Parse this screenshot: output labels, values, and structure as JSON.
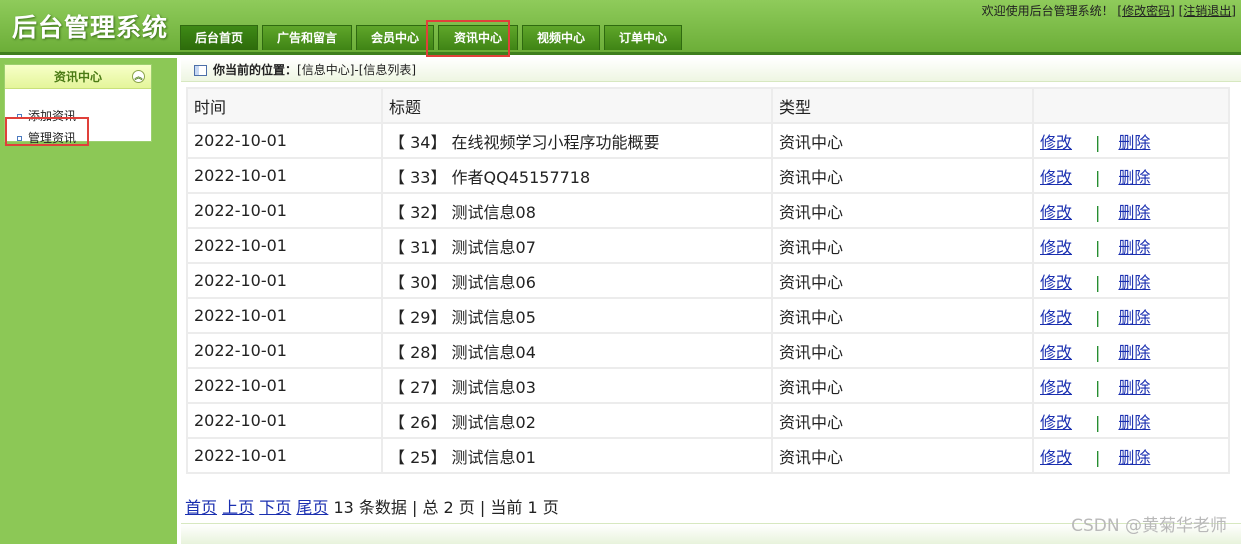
{
  "header": {
    "app_title": "后台管理系统",
    "welcome_text": "欢迎使用后台管理系统！",
    "change_password": "[修改密码]",
    "logout": "[注销退出]"
  },
  "nav": {
    "tabs": [
      {
        "label": "后台首页"
      },
      {
        "label": "广告和留言"
      },
      {
        "label": "会员中心"
      },
      {
        "label": "资讯中心"
      },
      {
        "label": "视频中心"
      },
      {
        "label": "订单中心"
      }
    ]
  },
  "sidebar": {
    "panel_title": "资讯中心",
    "items": [
      {
        "label": "添加资讯"
      },
      {
        "label": "管理资讯"
      }
    ]
  },
  "breadcrumb": {
    "label": "你当前的位置：",
    "path": "[信息中心]-[信息列表]"
  },
  "table": {
    "headers": [
      "时间",
      "标题",
      "类型",
      ""
    ],
    "rows": [
      {
        "time": "2022-10-01",
        "title": "【 34】 在线视频学习小程序功能概要",
        "type": "资讯中心",
        "edit": "修改",
        "sep": "|",
        "delete": "删除"
      },
      {
        "time": "2022-10-01",
        "title": "【 33】 作者QQ45157718",
        "type": "资讯中心",
        "edit": "修改",
        "sep": "|",
        "delete": "删除"
      },
      {
        "time": "2022-10-01",
        "title": "【 32】 测试信息08",
        "type": "资讯中心",
        "edit": "修改",
        "sep": "|",
        "delete": "删除"
      },
      {
        "time": "2022-10-01",
        "title": "【 31】 测试信息07",
        "type": "资讯中心",
        "edit": "修改",
        "sep": "|",
        "delete": "删除"
      },
      {
        "time": "2022-10-01",
        "title": "【 30】 测试信息06",
        "type": "资讯中心",
        "edit": "修改",
        "sep": "|",
        "delete": "删除"
      },
      {
        "time": "2022-10-01",
        "title": "【 29】 测试信息05",
        "type": "资讯中心",
        "edit": "修改",
        "sep": "|",
        "delete": "删除"
      },
      {
        "time": "2022-10-01",
        "title": "【 28】 测试信息04",
        "type": "资讯中心",
        "edit": "修改",
        "sep": "|",
        "delete": "删除"
      },
      {
        "time": "2022-10-01",
        "title": "【 27】 测试信息03",
        "type": "资讯中心",
        "edit": "修改",
        "sep": "|",
        "delete": "删除"
      },
      {
        "time": "2022-10-01",
        "title": "【 26】 测试信息02",
        "type": "资讯中心",
        "edit": "修改",
        "sep": "|",
        "delete": "删除"
      },
      {
        "time": "2022-10-01",
        "title": "【 25】 测试信息01",
        "type": "资讯中心",
        "edit": "修改",
        "sep": "|",
        "delete": "删除"
      }
    ]
  },
  "pager": {
    "first": "首页",
    "prev": "上页",
    "next": "下页",
    "last": "尾页",
    "summary": "13 条数据 | 总 2 页 | 当前 1 页"
  },
  "watermark": "CSDN @黄菊华老师",
  "colors": {
    "header_green": "#7bbd47",
    "tab_green": "#4a921f",
    "sidebar_green": "#8cc856",
    "link_blue": "#1a2fb0",
    "highlight_red": "#e0403a"
  }
}
